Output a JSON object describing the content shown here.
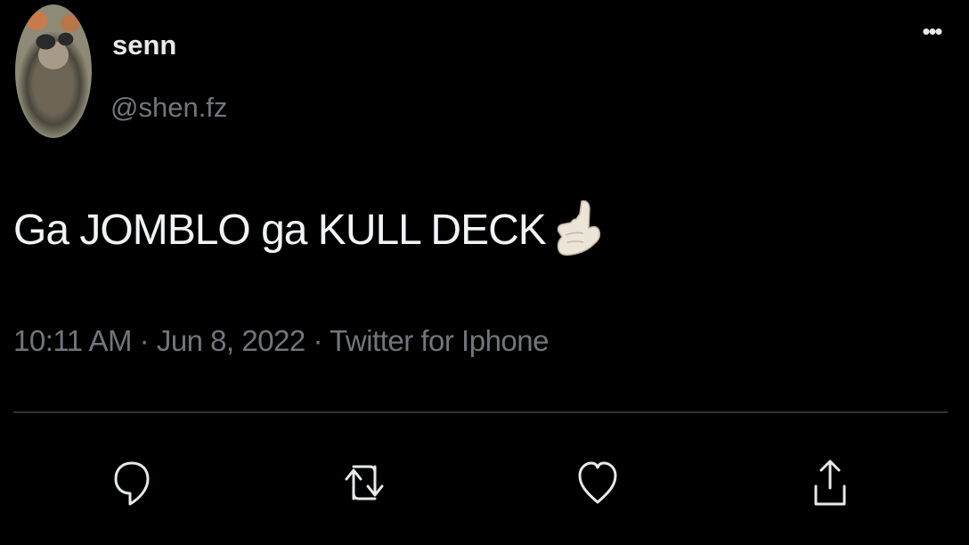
{
  "author": {
    "display_name": "senn",
    "handle": "@shen.fz"
  },
  "menu": {
    "more_label": "•••"
  },
  "tweet": {
    "text": "Ga JOMBLO ga KULL DECK",
    "emoji": "call-me-hand-emoji"
  },
  "meta": {
    "time": "10:11 AM",
    "separator": " · ",
    "date": "Jun 8, 2022",
    "source": "Twitter for Iphone"
  },
  "actions": {
    "reply_icon": "reply-icon",
    "retweet_icon": "retweet-icon",
    "like_icon": "heart-icon",
    "share_icon": "share-icon"
  },
  "colors": {
    "background": "#000000",
    "text": "#e7e9ea",
    "secondary_text": "#71767b",
    "divider": "#2f3336"
  }
}
